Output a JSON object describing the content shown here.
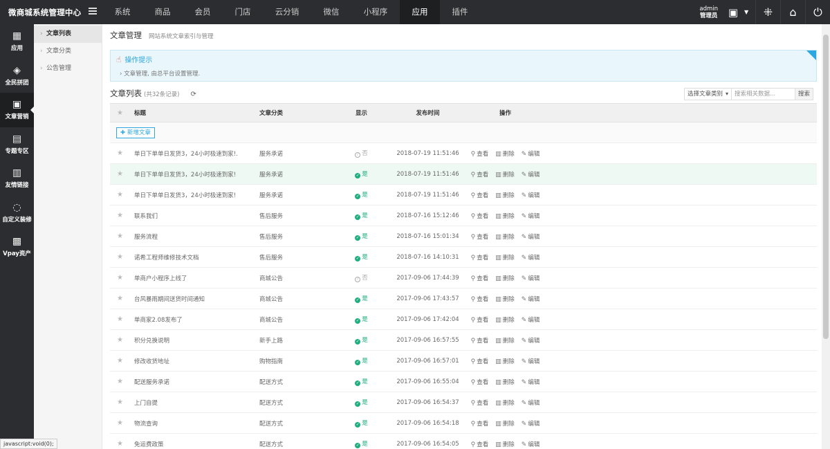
{
  "app": {
    "brand": "微商城系统管理中心"
  },
  "topnav": {
    "items": [
      "系统",
      "商品",
      "会员",
      "门店",
      "云分销",
      "微信",
      "小程序",
      "应用",
      "插件"
    ],
    "active": "应用"
  },
  "user": {
    "name": "admin",
    "role": "管理员"
  },
  "icons": {
    "menu_toggle": "menu-lines-icon",
    "contact": "id-card-icon",
    "dropdown": "caret-down-icon",
    "app_grid": "dots-icon",
    "home": "home-icon",
    "power": "power-icon"
  },
  "sidebar": {
    "items": [
      {
        "label": "应用",
        "icon": "apps-icon",
        "glyph": "▦"
      },
      {
        "label": "全民拼团",
        "icon": "group-buy-icon",
        "glyph": "◈"
      },
      {
        "label": "文章营销",
        "icon": "article-marketing-icon",
        "glyph": "▣"
      },
      {
        "label": "专题专区",
        "icon": "topic-icon",
        "glyph": "▤"
      },
      {
        "label": "友情链接",
        "icon": "link-icon",
        "glyph": "▥"
      },
      {
        "label": "自定义装修",
        "icon": "decorate-icon",
        "glyph": "◌"
      },
      {
        "label": "Vpay资产",
        "icon": "vpay-icon",
        "glyph": "▩"
      }
    ],
    "active": "文章营销"
  },
  "subnav": {
    "items": [
      "文章列表",
      "文章分类",
      "公告管理"
    ],
    "active": "文章列表"
  },
  "page": {
    "title": "文章管理",
    "subtitle": "网站系统文章索引与管理"
  },
  "tips": {
    "title": "操作提示",
    "text": "文章管理, 由总平台设置管理."
  },
  "list": {
    "title": "文章列表",
    "count": "(共32条记录)"
  },
  "search": {
    "category_label": "选择文章类别",
    "placeholder": "搜索相关数据...",
    "button": "搜索"
  },
  "table": {
    "columns": [
      "标题",
      "文章分类",
      "显示",
      "发布时间",
      "操作"
    ],
    "add_button": "新增文章",
    "ops": {
      "view": "查看",
      "delete": "删除",
      "edit": "编辑"
    },
    "rows": [
      {
        "title": "单日下单单日发货3，24小时极速到家!.",
        "category": "服务承诺",
        "show": "否",
        "time": "2018-07-19 11:51:46"
      },
      {
        "title": "单日下单单日发货3，24小时极速到家!",
        "category": "服务承诺",
        "show": "是",
        "time": "2018-07-19 11:51:46"
      },
      {
        "title": "单日下单单日发货3，24小时极速到家!",
        "category": "服务承诺",
        "show": "是",
        "time": "2018-07-19 11:51:46"
      },
      {
        "title": "联系我们",
        "category": "售后服务",
        "show": "是",
        "time": "2018-07-16 15:12:46"
      },
      {
        "title": "服务流程",
        "category": "售后服务",
        "show": "是",
        "time": "2018-07-16 15:01:34"
      },
      {
        "title": "诺希工程师维修技术文档",
        "category": "售后服务",
        "show": "是",
        "time": "2018-07-16 14:10:31"
      },
      {
        "title": "单商户小程序上线了",
        "category": "商城公告",
        "show": "否",
        "time": "2017-09-06 17:44:39"
      },
      {
        "title": "台风暴雨期间送货时间通知",
        "category": "商城公告",
        "show": "是",
        "time": "2017-09-06 17:43:57"
      },
      {
        "title": "单商家2.08发布了",
        "category": "商城公告",
        "show": "是",
        "time": "2017-09-06 17:42:04"
      },
      {
        "title": "积分兑换说明",
        "category": "新手上路",
        "show": "是",
        "time": "2017-09-06 16:57:55"
      },
      {
        "title": "修改收货地址",
        "category": "购物指南",
        "show": "是",
        "time": "2017-09-06 16:57:01"
      },
      {
        "title": "配送服务承诺",
        "category": "配送方式",
        "show": "是",
        "time": "2017-09-06 16:55:04"
      },
      {
        "title": "上门自提",
        "category": "配送方式",
        "show": "是",
        "time": "2017-09-06 16:54:37"
      },
      {
        "title": "物流查询",
        "category": "配送方式",
        "show": "是",
        "time": "2017-09-06 16:54:18"
      },
      {
        "title": "免运费政策",
        "category": "配送方式",
        "show": "是",
        "time": "2017-09-06 16:54:05"
      }
    ],
    "highlighted_row": 1
  },
  "statusbar": {
    "text": "javascript:void(0);"
  }
}
